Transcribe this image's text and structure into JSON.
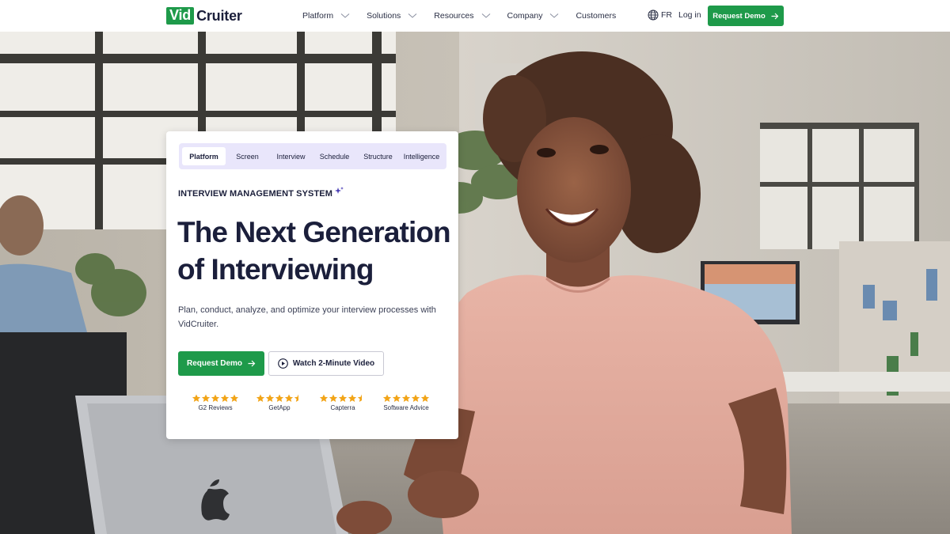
{
  "header": {
    "logo": {
      "box_text": "Vid",
      "rest_text": "Cruiter"
    },
    "nav": [
      {
        "label": "Platform",
        "has_dropdown": true
      },
      {
        "label": "Solutions",
        "has_dropdown": true
      },
      {
        "label": "Resources",
        "has_dropdown": true
      },
      {
        "label": "Company",
        "has_dropdown": true
      },
      {
        "label": "Customers",
        "has_dropdown": false
      }
    ],
    "language": {
      "label": "FR",
      "icon": "globe-icon"
    },
    "login_label": "Log in",
    "demo_label": "Request Demo"
  },
  "card": {
    "tabs": [
      {
        "label": "Platform",
        "active": true
      },
      {
        "label": "Screen",
        "active": false
      },
      {
        "label": "Interview",
        "active": false
      },
      {
        "label": "Schedule",
        "active": false
      },
      {
        "label": "Structure",
        "active": false
      },
      {
        "label": "Intelligence",
        "active": false
      }
    ],
    "eyebrow": "INTERVIEW MANAGEMENT SYSTEM",
    "headline_line1": "The Next Generation",
    "headline_line2": "of Interviewing",
    "subtext": "Plan, conduct, analyze, and optimize your interview processes with VidCruiter.",
    "primary_button": "Request Demo",
    "secondary_button": "Watch 2-Minute Video",
    "reviews": [
      {
        "label": "G2 Reviews",
        "rating": 5
      },
      {
        "label": "GetApp",
        "rating": 4.5
      },
      {
        "label": "Capterra",
        "rating": 4.5
      },
      {
        "label": "Software Advice",
        "rating": 5
      }
    ]
  },
  "colors": {
    "brand_green": "#1e9a4a",
    "navy_text": "#1b1f3b",
    "tab_bg": "#e9e6fb",
    "star": "#f2a417"
  }
}
